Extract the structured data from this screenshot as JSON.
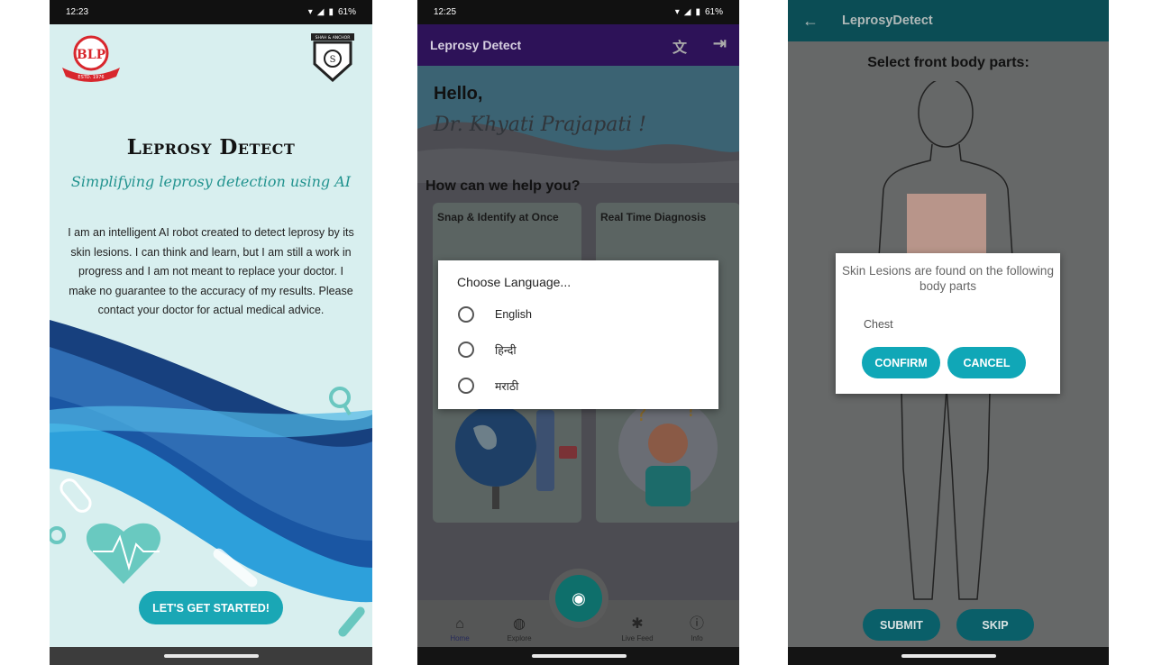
{
  "screen1": {
    "status": {
      "time": "12:23",
      "battery": "61%"
    },
    "logo_left_text": "BLP",
    "logo_left_sub": "ESTD. 1976",
    "logo_right_text": "SHAH & ANCHOR",
    "title": "Leprosy Detect",
    "subtitle": "Simplifying leprosy detection using AI",
    "description": "I am an intelligent AI robot created to detect leprosy by its skin lesions. I can think and learn, but I am still a work in progress and I am not meant to replace your doctor. I make no guarantee to the accuracy of my results. Please contact your doctor for actual medical advice.",
    "start_button": "LET'S GET STARTED!"
  },
  "screen2": {
    "status": {
      "time": "12:25",
      "battery": "61%"
    },
    "app_title": "Leprosy Detect",
    "greeting": "Hello,",
    "user_name": "Dr. Khyati Prajapati !",
    "help_prompt": "How can we help you?",
    "cards": [
      {
        "label": "Snap & Identify at Once"
      },
      {
        "label": "Real Time Diagnosis"
      }
    ],
    "dialog": {
      "title": "Choose Language...",
      "options": [
        "English",
        "हिन्दी",
        "मराठी"
      ]
    },
    "tabs": [
      {
        "label": "Home",
        "icon": "home-icon"
      },
      {
        "label": "Explore",
        "icon": "globe-icon"
      },
      {
        "label": "Live Feed",
        "icon": "live-feed-icon"
      },
      {
        "label": "Info",
        "icon": "info-icon"
      }
    ],
    "colors": {
      "appbar": "#2d1258",
      "fab": "#0e6f6b"
    }
  },
  "screen3": {
    "app_title": "LeprosyDetect",
    "heading": "Select front body parts:",
    "dialog": {
      "message": "Skin Lesions are found on the following body parts",
      "part": "Chest",
      "confirm": "CONFIRM",
      "cancel": "CANCEL"
    },
    "submit": "SUBMIT",
    "skip": "SKIP",
    "colors": {
      "accent": "#10a7b7"
    }
  }
}
